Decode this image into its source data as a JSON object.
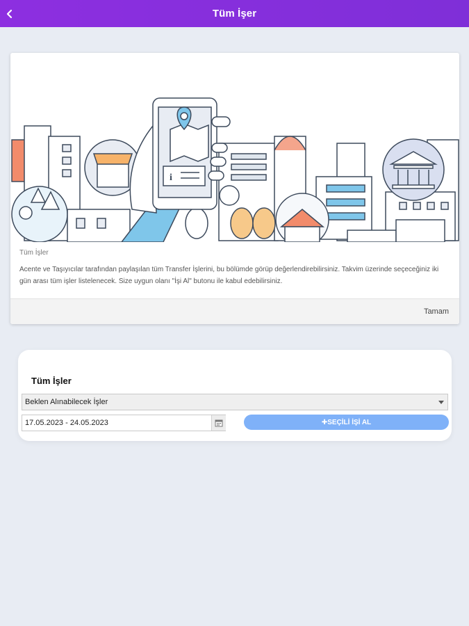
{
  "header": {
    "title": "Tüm İşer",
    "back_icon": "chevron-left-icon"
  },
  "info_card": {
    "subtitle": "Tüm İşler",
    "text": "Acente ve Taşıyıcılar tarafından paylaşılan tüm Transfer İşlerini, bu bölümde görüp değerlendirebilirsiniz. Takvim üzerinde seçeceğiniz iki gün arası tüm işler listelenecek. Size uygun olanı \"İşi Al\" butonu ile kabul edebilirsiniz.",
    "ok_label": "Tamam"
  },
  "filter_panel": {
    "title": "Tüm İşler",
    "select_value": "Beklen Alınabilecek İşler",
    "date_range": "17.05.2023 - 24.05.2023",
    "take_button": "✚SEÇİLİ İŞİ AL"
  },
  "colors": {
    "header": "#8a2be2",
    "button": "#7fb1f8",
    "background": "#e8ecf3"
  }
}
